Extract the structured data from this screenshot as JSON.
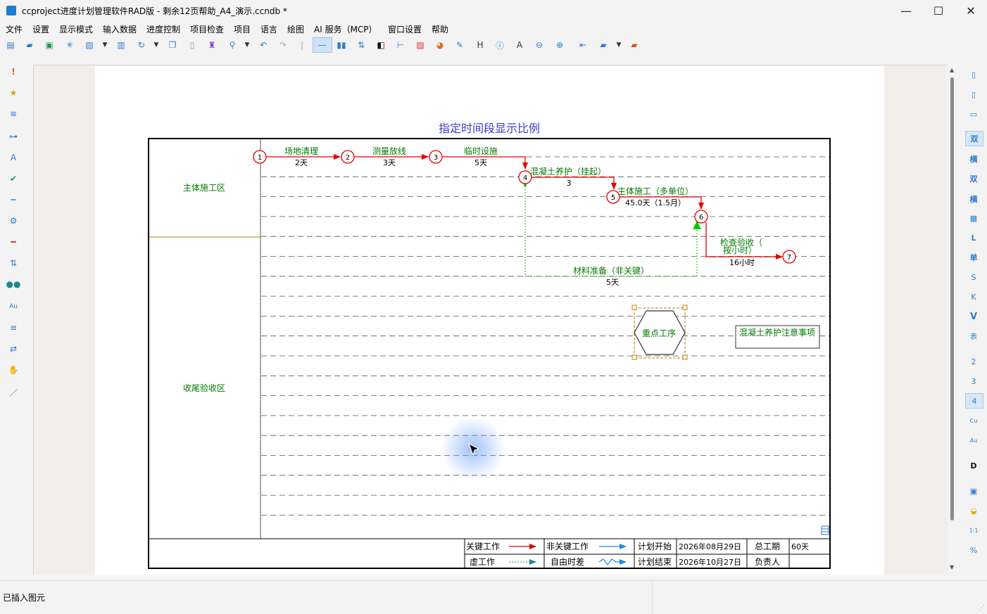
{
  "window": {
    "title": "ccproject进度计划管理软件RAD版 - 剩余12页帮助_A4_演示.ccndb *",
    "minimize": "—",
    "maximize": "☐",
    "close": "✕"
  },
  "menu": [
    "文件",
    "设置",
    "显示模式",
    "输入数据",
    "进度控制",
    "项目检查",
    "项目",
    "语言",
    "绘图",
    "AI 服务（MCP）",
    "窗口设置",
    "帮助"
  ],
  "right_toolbar": [
    "双",
    "横",
    "双",
    "横",
    "L",
    "单",
    "S",
    "K",
    "V",
    "表",
    "2",
    "3",
    "4",
    "Cu",
    "Au",
    "D",
    "1:1",
    "%"
  ],
  "diagram": {
    "title": "指定时间段显示比例",
    "zones": [
      "主体施工区",
      "收尾验收区"
    ],
    "nodes": [
      "1",
      "2",
      "3",
      "4",
      "5",
      "6",
      "7"
    ],
    "tasks": [
      {
        "name": "场地清理",
        "duration": "2天"
      },
      {
        "name": "测量放线",
        "duration": "3天"
      },
      {
        "name": "临时设施",
        "duration": "5天"
      },
      {
        "name": "混凝土养护（挂起）",
        "duration": "3"
      },
      {
        "name": "主体施工（多单位）",
        "duration": "45.0天（1.5月）"
      },
      {
        "name": "检查验收（",
        "name2": "按小时）",
        "duration": "16小时"
      },
      {
        "name": "材料准备（非关键）",
        "duration": "5天"
      }
    ],
    "hexagon_label": "重点工序",
    "note_label": "混凝土养护注意事项",
    "colors": {
      "critical": "#e00000",
      "noncritical": "#1e88e5",
      "dummy": "#1e8a8a",
      "text_green": "#007a00",
      "title": "#3a3ad0"
    }
  },
  "legend": {
    "critical": "关键工作",
    "noncritical": "非关键工作",
    "dummy": "虚工作",
    "free_float": "自由时差",
    "plan_start_label": "计划开始",
    "plan_start": "2026年08月29日",
    "plan_end_label": "计划结束",
    "plan_end": "2026年10月27日",
    "total_label": "总工期",
    "total": "60天",
    "owner_label": "负责人",
    "owner": ""
  },
  "status": {
    "text": "已插入图元"
  }
}
